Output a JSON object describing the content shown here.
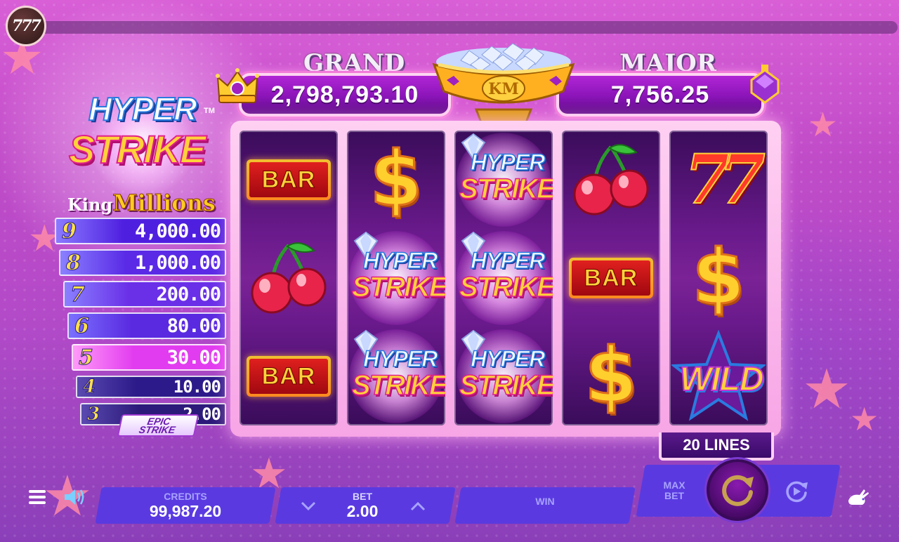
{
  "header": {
    "brand_badge": "777"
  },
  "game_logo": {
    "line1": "HYPER",
    "line2": "STRIKE",
    "tm": "TM",
    "brand_prefix": "King",
    "brand_name": "Millions"
  },
  "ladder": [
    {
      "count": "9",
      "value": "4,000.00",
      "color": "#4f1fe0"
    },
    {
      "count": "8",
      "value": "1,000.00",
      "color": "#5a2ae6"
    },
    {
      "count": "7",
      "value": "200.00",
      "color": "#6a30e8"
    },
    {
      "count": "6",
      "value": "80.00",
      "color": "#5a2ae0"
    },
    {
      "count": "5",
      "value": "30.00",
      "color": "#e23cf0"
    },
    {
      "count": "4",
      "value": "10.00",
      "color": "#2c1a8a"
    },
    {
      "count": "3",
      "value": "2.00",
      "color": "#2c1a7a"
    }
  ],
  "epic_logo": {
    "line1": "EPIC",
    "line2": "STRIKE"
  },
  "jackpots": {
    "grand": {
      "label": "GRAND",
      "value": "2,798,793.10"
    },
    "major": {
      "label": "MAJOR",
      "value": "7,756.25"
    },
    "bowl_emblem": "KM"
  },
  "reels": [
    [
      "bar",
      "cherry",
      "bar"
    ],
    [
      "dollar",
      "hyper_strike",
      "hyper_strike"
    ],
    [
      "hyper_strike",
      "hyper_strike",
      "hyper_strike"
    ],
    [
      "cherry",
      "bar",
      "dollar"
    ],
    [
      "seven",
      "dollar",
      "wild"
    ]
  ],
  "symbols": {
    "bar_text": "BAR",
    "dollar_text": "$",
    "seven_text": "77",
    "wild_text": "WILD",
    "hyper_line1": "HYPER",
    "hyper_line2": "STRIKE"
  },
  "lines_badge": "20 LINES",
  "bottom_bar": {
    "credits_label": "CREDITS",
    "credits_value": "99,987.20",
    "bet_label": "BET",
    "bet_value": "2.00",
    "win_label": "WIN",
    "win_value": "",
    "max_bet_line1": "MAX",
    "max_bet_line2": "BET"
  },
  "icons": {
    "menu": "menu-icon",
    "sound": "sound-icon",
    "bet_down": "chevron-down-icon",
    "bet_up": "chevron-up-icon",
    "spin": "spin-icon",
    "autoplay": "autoplay-icon",
    "turbo": "turbo-rabbit-icon"
  },
  "colors": {
    "panel": "#5a3ae0",
    "panel_label": "#a8a2ff",
    "jackpot_panel": "#8a14b8"
  }
}
